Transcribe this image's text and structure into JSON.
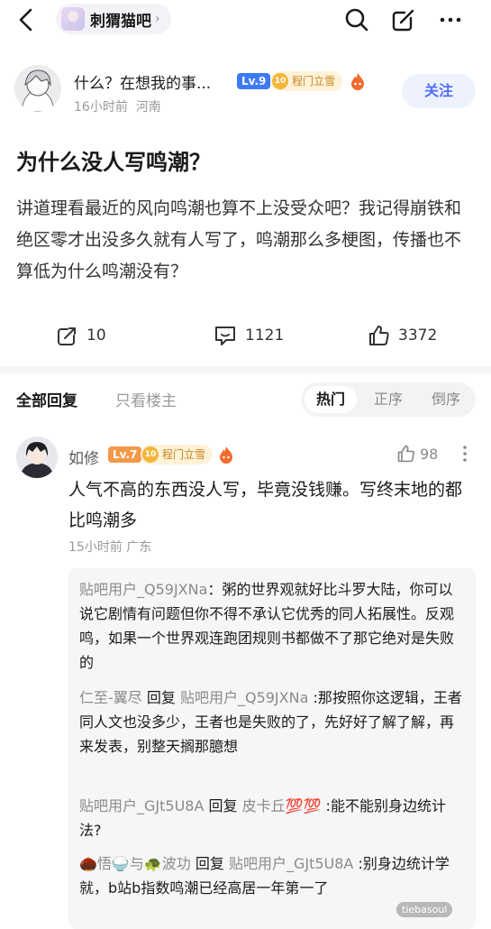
{
  "header": {
    "forum_name": "刺猬猫吧",
    "chevron": "›",
    "icons": [
      "back-icon",
      "search-icon",
      "edit-icon",
      "more-icon"
    ]
  },
  "author": {
    "name": "什么？在想我的事...",
    "level": "Lv.9",
    "badge_num": "10",
    "badge_text": "程门立雪",
    "time": "16小时前",
    "location": "河南",
    "follow": "关注"
  },
  "post": {
    "title": "为什么没人写鸣潮？",
    "body": "讲道理看最近的风向鸣潮也算不上没受众吧？我记得崩铁和绝区零才出没多久就有人写了，鸣潮那么多梗图，传播也不算低为什么鸣潮没有？"
  },
  "stats": {
    "share": "10",
    "comments": "1121",
    "likes": "3372"
  },
  "sort": {
    "all_replies": "全部回复",
    "owner_only": "只看楼主",
    "options": [
      "热门",
      "正序",
      "倒序"
    ],
    "active": "热门"
  },
  "reply": {
    "name": "如修",
    "level": "Lv.7",
    "badge_num": "10",
    "badge_text": "程门立雪",
    "likes": "98",
    "text": "人气不高的东西没人写，毕竟没钱赚。写终末地的都比鸣潮多",
    "time": "15小时前",
    "location": "广东",
    "subs": [
      {
        "user": "贴吧用户_Q59JXNa",
        "sep": "：",
        "text": "粥的世界观就好比斗罗大陆，你可以说它剧情有问题但你不得不承认它优秀的同人拓展性。反观鸣，如果一个世界观连跑团规则书都做不了那它绝对是失败的"
      },
      {
        "user": "仁至-翼尽",
        "reply_word": " 回复 ",
        "target": "贴吧用户_Q59JXNa",
        "sep": " :",
        "text": "那按照你这逻辑，王者同人文也没多少，王者也是失败的了，先好好了解了解，再来发表，别整天搁那臆想"
      },
      {
        "user": "贴吧用户_GJt5U8A",
        "reply_word": " 回复 ",
        "target": "皮卡丘💯💯",
        "sep": " :",
        "text": "能不能别身边统计法?"
      },
      {
        "user": "🌰悟🍚与🐢波功",
        "reply_word": " 回复 ",
        "target": "贴吧用户_GJt5U8A",
        "sep": " :",
        "text": "别身边统计学就，b站b指数鸣潮已经高居一年第一了"
      }
    ]
  },
  "watermark": "tiebasoul",
  "colors": {
    "accent": "#4f6ef7",
    "lv9": "#3c7bf5",
    "lv7": "#f2994a",
    "badge_bg": "#fff2d9",
    "badge_text": "#c8861b"
  }
}
